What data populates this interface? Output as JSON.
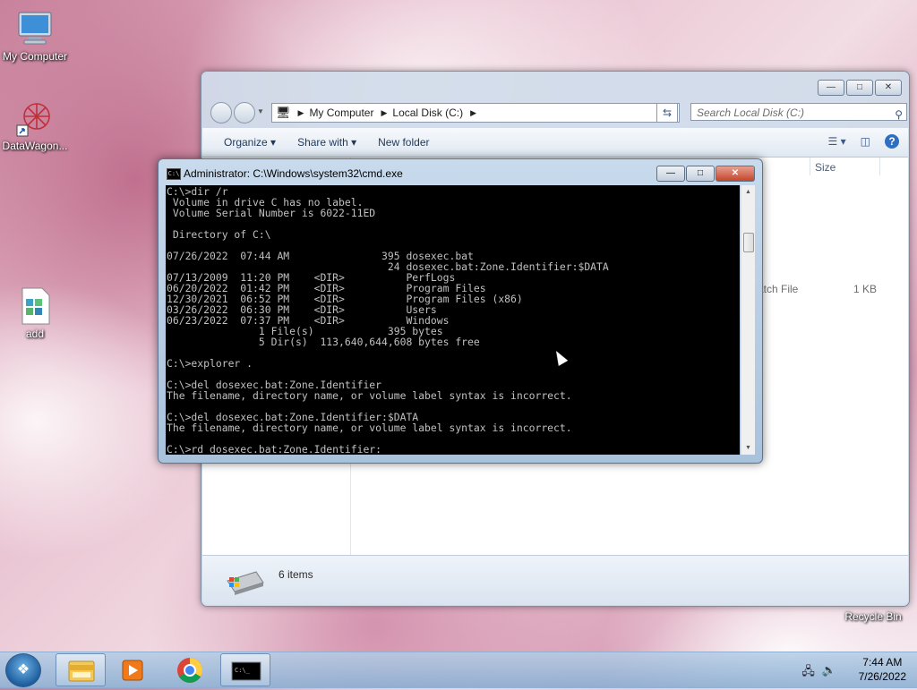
{
  "desktop": {
    "icons": [
      {
        "label": "My Computer",
        "icon": "computer-icon"
      },
      {
        "label": "DataWagon...",
        "icon": "datawagon-shortcut-icon"
      },
      {
        "label": "add",
        "icon": "registry-file-icon"
      },
      {
        "label": "Recycle Bin",
        "icon": "recycle-bin-icon"
      }
    ]
  },
  "explorer": {
    "address": {
      "crumb1": "My Computer",
      "crumb2": "Local Disk (C:)"
    },
    "search_placeholder": "Search Local Disk (C:)",
    "toolbar": {
      "organize": "Organize",
      "share_with": "Share with",
      "new_folder": "New folder"
    },
    "columns": {
      "size": "Size"
    },
    "file_row": {
      "type": "atch File",
      "size": "1 KB"
    },
    "status": {
      "items": "6 items"
    }
  },
  "cmd": {
    "title": "Administrator: C:\\Windows\\system32\\cmd.exe",
    "console_text": "C:\\>dir /r\n Volume in drive C has no label.\n Volume Serial Number is 6022-11ED\n\n Directory of C:\\\n\n07/26/2022  07:44 AM               395 dosexec.bat\n                                    24 dosexec.bat:Zone.Identifier:$DATA\n07/13/2009  11:20 PM    <DIR>          PerfLogs\n06/20/2022  01:42 PM    <DIR>          Program Files\n12/30/2021  06:52 PM    <DIR>          Program Files (x86)\n03/26/2022  06:30 PM    <DIR>          Users\n06/23/2022  07:37 PM    <DIR>          Windows\n               1 File(s)            395 bytes\n               5 Dir(s)  113,640,644,608 bytes free\n\nC:\\>explorer .\n\nC:\\>del dosexec.bat:Zone.Identifier\nThe filename, directory name, or volume label syntax is incorrect.\n\nC:\\>del dosexec.bat:Zone.Identifier:$DATA\nThe filename, directory name, or volume label syntax is incorrect.\n\nC:\\>rd dosexec.bat:Zone.Identifier:"
  },
  "taskbar": {
    "pinned": [
      "windows-explorer-icon",
      "media-player-icon",
      "chrome-icon",
      "cmd-icon"
    ],
    "clock": {
      "time": "7:44 AM",
      "date": "7/26/2022"
    }
  }
}
